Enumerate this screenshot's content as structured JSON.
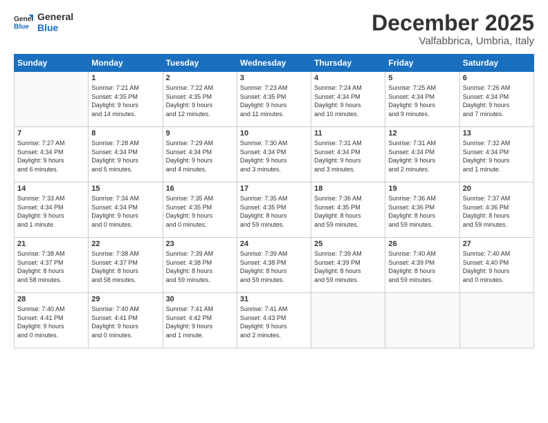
{
  "logo": {
    "line1": "General",
    "line2": "Blue"
  },
  "title": "December 2025",
  "subtitle": "Valfabbrica, Umbria, Italy",
  "weekdays": [
    "Sunday",
    "Monday",
    "Tuesday",
    "Wednesday",
    "Thursday",
    "Friday",
    "Saturday"
  ],
  "weeks": [
    [
      {
        "day": "",
        "info": ""
      },
      {
        "day": "1",
        "info": "Sunrise: 7:21 AM\nSunset: 4:35 PM\nDaylight: 9 hours\nand 14 minutes."
      },
      {
        "day": "2",
        "info": "Sunrise: 7:22 AM\nSunset: 4:35 PM\nDaylight: 9 hours\nand 12 minutes."
      },
      {
        "day": "3",
        "info": "Sunrise: 7:23 AM\nSunset: 4:35 PM\nDaylight: 9 hours\nand 11 minutes."
      },
      {
        "day": "4",
        "info": "Sunrise: 7:24 AM\nSunset: 4:34 PM\nDaylight: 9 hours\nand 10 minutes."
      },
      {
        "day": "5",
        "info": "Sunrise: 7:25 AM\nSunset: 4:34 PM\nDaylight: 9 hours\nand 9 minutes."
      },
      {
        "day": "6",
        "info": "Sunrise: 7:26 AM\nSunset: 4:34 PM\nDaylight: 9 hours\nand 7 minutes."
      }
    ],
    [
      {
        "day": "7",
        "info": "Sunrise: 7:27 AM\nSunset: 4:34 PM\nDaylight: 9 hours\nand 6 minutes."
      },
      {
        "day": "8",
        "info": "Sunrise: 7:28 AM\nSunset: 4:34 PM\nDaylight: 9 hours\nand 5 minutes."
      },
      {
        "day": "9",
        "info": "Sunrise: 7:29 AM\nSunset: 4:34 PM\nDaylight: 9 hours\nand 4 minutes."
      },
      {
        "day": "10",
        "info": "Sunrise: 7:30 AM\nSunset: 4:34 PM\nDaylight: 9 hours\nand 3 minutes."
      },
      {
        "day": "11",
        "info": "Sunrise: 7:31 AM\nSunset: 4:34 PM\nDaylight: 9 hours\nand 3 minutes."
      },
      {
        "day": "12",
        "info": "Sunrise: 7:31 AM\nSunset: 4:34 PM\nDaylight: 9 hours\nand 2 minutes."
      },
      {
        "day": "13",
        "info": "Sunrise: 7:32 AM\nSunset: 4:34 PM\nDaylight: 9 hours\nand 1 minute."
      }
    ],
    [
      {
        "day": "14",
        "info": "Sunrise: 7:33 AM\nSunset: 4:34 PM\nDaylight: 9 hours\nand 1 minute."
      },
      {
        "day": "15",
        "info": "Sunrise: 7:34 AM\nSunset: 4:34 PM\nDaylight: 9 hours\nand 0 minutes."
      },
      {
        "day": "16",
        "info": "Sunrise: 7:35 AM\nSunset: 4:35 PM\nDaylight: 9 hours\nand 0 minutes."
      },
      {
        "day": "17",
        "info": "Sunrise: 7:35 AM\nSunset: 4:35 PM\nDaylight: 8 hours\nand 59 minutes."
      },
      {
        "day": "18",
        "info": "Sunrise: 7:36 AM\nSunset: 4:35 PM\nDaylight: 8 hours\nand 59 minutes."
      },
      {
        "day": "19",
        "info": "Sunrise: 7:36 AM\nSunset: 4:36 PM\nDaylight: 8 hours\nand 59 minutes."
      },
      {
        "day": "20",
        "info": "Sunrise: 7:37 AM\nSunset: 4:36 PM\nDaylight: 8 hours\nand 59 minutes."
      }
    ],
    [
      {
        "day": "21",
        "info": "Sunrise: 7:38 AM\nSunset: 4:37 PM\nDaylight: 8 hours\nand 58 minutes."
      },
      {
        "day": "22",
        "info": "Sunrise: 7:38 AM\nSunset: 4:37 PM\nDaylight: 8 hours\nand 58 minutes."
      },
      {
        "day": "23",
        "info": "Sunrise: 7:39 AM\nSunset: 4:38 PM\nDaylight: 8 hours\nand 59 minutes."
      },
      {
        "day": "24",
        "info": "Sunrise: 7:39 AM\nSunset: 4:38 PM\nDaylight: 8 hours\nand 59 minutes."
      },
      {
        "day": "25",
        "info": "Sunrise: 7:39 AM\nSunset: 4:39 PM\nDaylight: 8 hours\nand 59 minutes."
      },
      {
        "day": "26",
        "info": "Sunrise: 7:40 AM\nSunset: 4:39 PM\nDaylight: 8 hours\nand 59 minutes."
      },
      {
        "day": "27",
        "info": "Sunrise: 7:40 AM\nSunset: 4:40 PM\nDaylight: 9 hours\nand 0 minutes."
      }
    ],
    [
      {
        "day": "28",
        "info": "Sunrise: 7:40 AM\nSunset: 4:41 PM\nDaylight: 9 hours\nand 0 minutes."
      },
      {
        "day": "29",
        "info": "Sunrise: 7:40 AM\nSunset: 4:41 PM\nDaylight: 9 hours\nand 0 minutes."
      },
      {
        "day": "30",
        "info": "Sunrise: 7:41 AM\nSunset: 4:42 PM\nDaylight: 9 hours\nand 1 minute."
      },
      {
        "day": "31",
        "info": "Sunrise: 7:41 AM\nSunset: 4:43 PM\nDaylight: 9 hours\nand 2 minutes."
      },
      {
        "day": "",
        "info": ""
      },
      {
        "day": "",
        "info": ""
      },
      {
        "day": "",
        "info": ""
      }
    ]
  ]
}
